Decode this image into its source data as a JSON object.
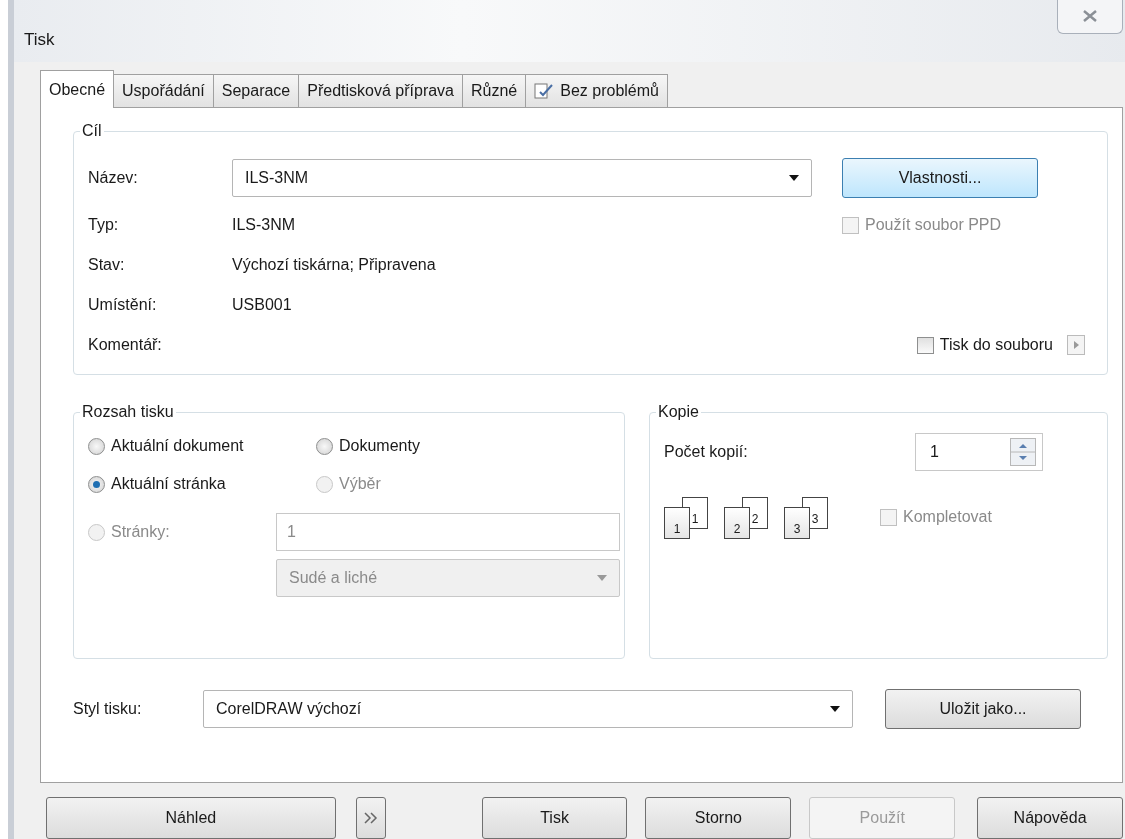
{
  "window": {
    "title": "Tisk"
  },
  "tabs": [
    {
      "label": "Obecné",
      "selected": true
    },
    {
      "label": "Uspořádání",
      "selected": false
    },
    {
      "label": "Separace",
      "selected": false
    },
    {
      "label": "Předtisková příprava",
      "selected": false
    },
    {
      "label": "Různé",
      "selected": false
    },
    {
      "label": "Bez problémů",
      "selected": false,
      "kind": "icon"
    }
  ],
  "target": {
    "legend": "Cíl",
    "name_label": "Název:",
    "name_value": "ILS-3NM",
    "properties_button": "Vlastnosti...",
    "info": [
      {
        "label": "Typ:",
        "value": "ILS-3NM"
      },
      {
        "label": "Stav:",
        "value": "Výchozí tiskárna; Připravena"
      },
      {
        "label": "Umístění:",
        "value": "USB001"
      },
      {
        "label": "Komentář:"
      }
    ],
    "use_ppd": {
      "label": "Použít soubor PPD",
      "checked": false,
      "disabled": true
    },
    "print_to_file": {
      "label": "Tisk do souboru",
      "checked": false,
      "disabled": false
    }
  },
  "range": {
    "legend": "Rozsah tisku",
    "options": [
      {
        "label": "Aktuální dokument",
        "selected": false,
        "disabled": false
      },
      {
        "label": "Dokumenty",
        "selected": false,
        "disabled": false
      },
      {
        "label": "Aktuální stránka",
        "selected": true,
        "disabled": false
      },
      {
        "label": "Výběr",
        "selected": false,
        "disabled": true
      },
      {
        "label": "Stránky:",
        "selected": false,
        "disabled": true
      }
    ],
    "pages_value": "1",
    "parity": "Sudé a liché"
  },
  "copies": {
    "legend": "Kopie",
    "count_label": "Počet kopií:",
    "count": "1",
    "sets": [
      {
        "front": "1",
        "back": "1"
      },
      {
        "front": "2",
        "back": "2"
      },
      {
        "front": "3",
        "back": "3"
      }
    ],
    "collate": {
      "label": "Kompletovat",
      "checked": false,
      "disabled": true
    }
  },
  "style": {
    "label": "Styl tisku:",
    "value": "CorelDRAW výchozí",
    "save_button": "Uložit jako..."
  },
  "buttons": [
    {
      "label": "Náhled",
      "kind": "wide",
      "disabled": false
    },
    {
      "kind": "icon",
      "disabled": false
    },
    {
      "label": "Tisk",
      "kind": "normal",
      "disabled": false
    },
    {
      "label": "Storno",
      "kind": "normal",
      "disabled": false
    },
    {
      "label": "Použít",
      "kind": "normal",
      "disabled": true
    },
    {
      "label": "Nápověda",
      "kind": "normal",
      "disabled": false
    }
  ]
}
